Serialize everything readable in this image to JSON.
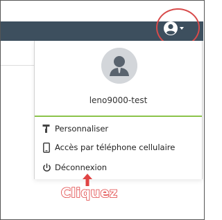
{
  "dropdown": {
    "username": "leno9000-test",
    "items": [
      {
        "label": "Personnaliser",
        "icon": "paint-roller-icon"
      },
      {
        "label": "Accès par téléphone cellulaire",
        "icon": "mobile-phone-icon"
      },
      {
        "label": "Déconnexion",
        "icon": "power-icon"
      }
    ]
  },
  "annotation": {
    "text": "Cliquez",
    "color": "#e04444"
  },
  "colors": {
    "navbar": "#3d4f5e",
    "accent_line": "#8bc34a",
    "highlight": "#d84a4a"
  }
}
